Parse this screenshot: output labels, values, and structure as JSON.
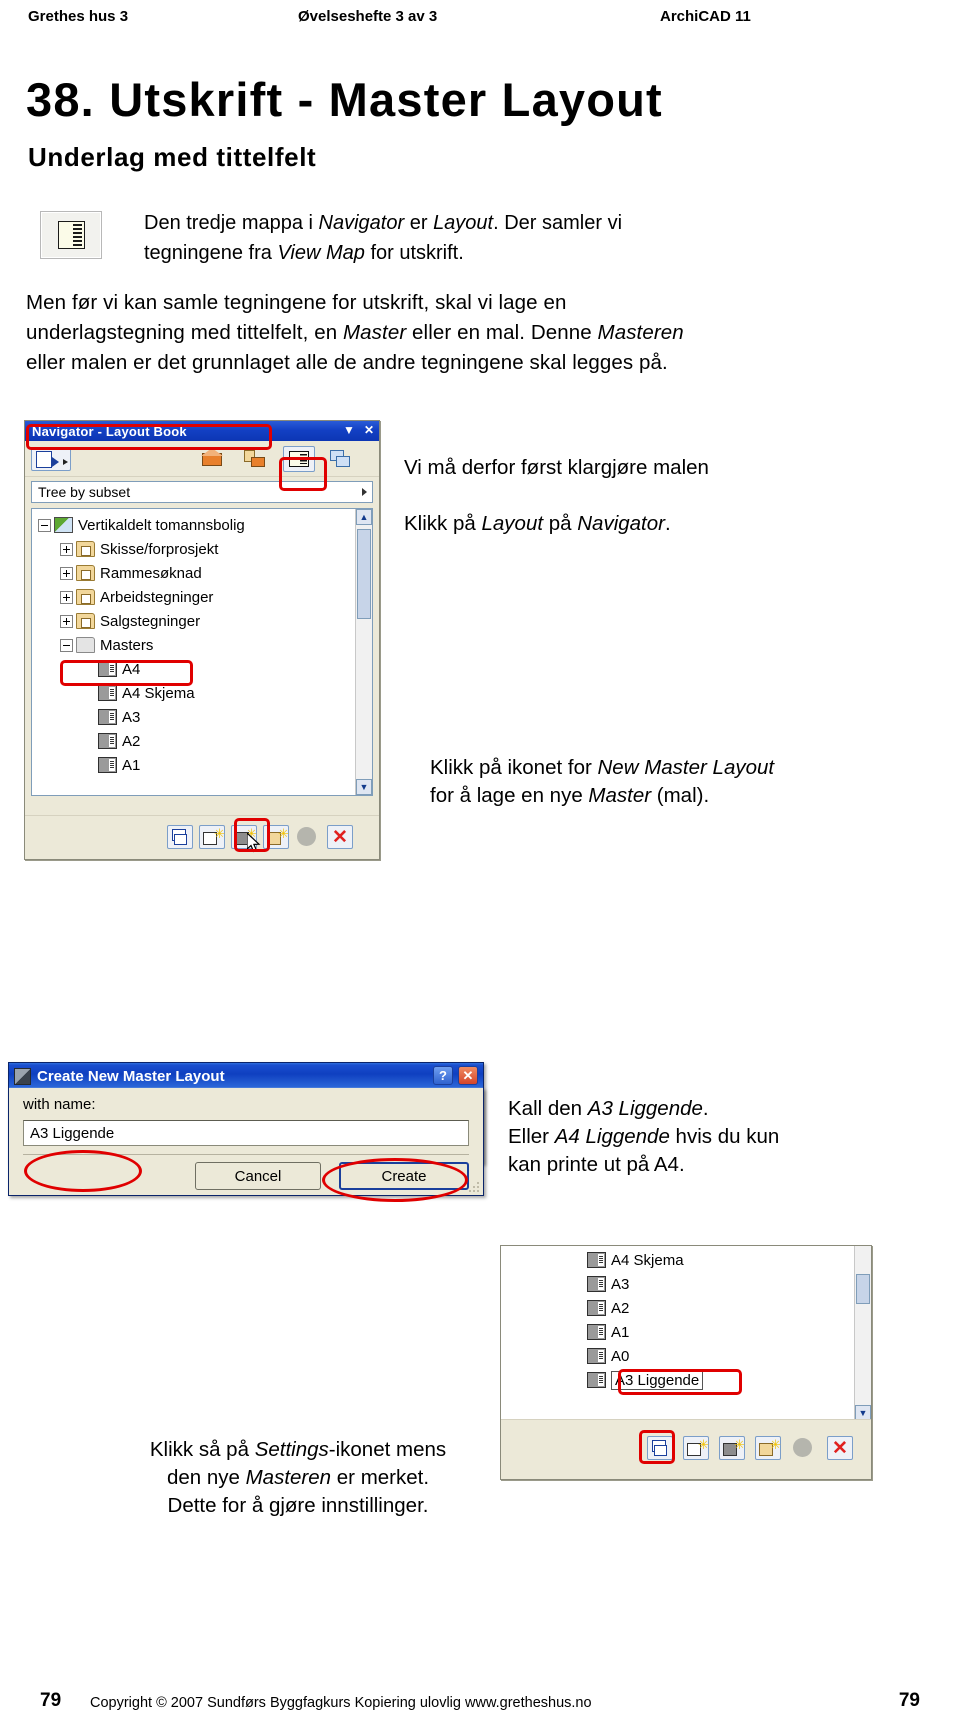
{
  "header": {
    "left": "Grethes hus 3",
    "center": "Øvelseshefte 3 av 3",
    "right": "ArchiCAD 11"
  },
  "title": "38. Utskrift - Master Layout",
  "subtitle": "Underlag med tittelfelt",
  "intro": {
    "icon_name": "layout-book-icon",
    "line1_a": "Den tredje mappa i ",
    "line1_em1": "Navigator",
    "line1_b": " er ",
    "line1_em2": "Layout",
    "line1_c": ".  Der samler vi",
    "line2_a": "tegningene fra ",
    "line2_em1": "View Map",
    "line2_b": " for utskrift."
  },
  "paragraph": {
    "l1": "Men før vi kan samle tegningene for utskrift, skal vi lage en",
    "l2_a": "underlagstegning med tittelfelt, en ",
    "l2_em1": "Master",
    "l2_b": " eller en mal.  Denne ",
    "l2_em2": "Masteren",
    "l3_a": "eller malen er det grunnlaget alle de andre tegningene skal legges på."
  },
  "navigator": {
    "title": "Navigator - Layout Book",
    "titlebar_buttons": [
      "▼",
      "✕"
    ],
    "toolbar_icons": [
      "navigate-export-icon",
      "project-map-icon",
      "view-map-icon",
      "layout-book-icon",
      "publisher-icon"
    ],
    "combo_value": "Tree by subset",
    "tree": [
      {
        "label": "Vertikaldelt tomannsbolig",
        "indent": 0,
        "expander": "minus",
        "icon": "project-icon"
      },
      {
        "label": "Skisse/forprosjekt",
        "indent": 1,
        "expander": "plus",
        "icon": "subset-folder-icon"
      },
      {
        "label": "Rammesøknad",
        "indent": 1,
        "expander": "plus",
        "icon": "subset-folder-icon"
      },
      {
        "label": "Arbeidstegninger",
        "indent": 1,
        "expander": "plus",
        "icon": "subset-folder-icon"
      },
      {
        "label": "Salgstegninger",
        "indent": 1,
        "expander": "plus",
        "icon": "subset-folder-icon"
      },
      {
        "label": "Masters",
        "indent": 1,
        "expander": "minus",
        "icon": "masters-folder-icon"
      },
      {
        "label": "A4",
        "indent": 2,
        "expander": "none",
        "icon": "master-layout-icon"
      },
      {
        "label": "A4 Skjema",
        "indent": 2,
        "expander": "none",
        "icon": "master-layout-icon"
      },
      {
        "label": "A3",
        "indent": 2,
        "expander": "none",
        "icon": "master-layout-active-icon"
      },
      {
        "label": "A2",
        "indent": 2,
        "expander": "none",
        "icon": "master-layout-icon"
      },
      {
        "label": "A1",
        "indent": 2,
        "expander": "none",
        "icon": "master-layout-icon"
      }
    ],
    "bottom_icons": [
      "settings-icon",
      "new-layout-icon",
      "new-master-layout-icon",
      "new-subset-icon",
      "update-icon",
      "delete-icon"
    ]
  },
  "tips": {
    "t1": "Vi må derfor først klargjøre malen",
    "t2_a": "Klikk på ",
    "t2_em": "Layout",
    "t2_b": " på ",
    "t2_em2": "Navigator",
    "t2_c": ".",
    "t3_a": "Klikk på ikonet for ",
    "t3_em": "New Master Layout",
    "t3_l2_a": "for å lage en nye ",
    "t3_em2": "Master",
    "t3_l2_b": " (mal).",
    "t4_l1_a": "Kall den ",
    "t4_l1_em": "A3 Liggende",
    "t4_l1_b": ".",
    "t4_l2_a": "Eller ",
    "t4_l2_em": "A4 Liggende",
    "t4_l2_b": " hvis du kun",
    "t4_l3": "kan printe ut på A4.",
    "t5_l1_a": "Klikk så på ",
    "t5_l1_em": "Settings",
    "t5_l1_b": "-ikonet mens",
    "t5_l2_a": "den nye ",
    "t5_l2_em": "Masteren",
    "t5_l2_b": " er merket.",
    "t5_l3": "Dette for å gjøre innstillinger."
  },
  "dialog": {
    "title": "Create New Master Layout",
    "help_button": "?",
    "close_button": "✕",
    "label": "with name:",
    "input_value": "A3 Liggende",
    "cancel_button": "Cancel",
    "create_button": "Create"
  },
  "navigator2": {
    "tree": [
      {
        "label": "A4 Skjema",
        "icon": "master-layout-icon"
      },
      {
        "label": "A3",
        "icon": "master-layout-active-icon"
      },
      {
        "label": "A2",
        "icon": "master-layout-icon"
      },
      {
        "label": "A1",
        "icon": "master-layout-icon"
      },
      {
        "label": "A0",
        "icon": "master-layout-icon"
      },
      {
        "label": "A3 Liggende",
        "icon": "master-layout-icon",
        "selected": true
      }
    ],
    "bottom_icons": [
      "settings-icon",
      "new-layout-icon",
      "new-master-layout-icon",
      "new-subset-icon",
      "update-icon",
      "delete-icon"
    ]
  },
  "footer": {
    "page_left": "79",
    "page_right": "79",
    "text": "Copyright © 2007  Sundførs Byggfagkurs   Kopiering ulovlig  www.gretheshus.no"
  },
  "colors": {
    "annotation_red": "#e00000",
    "titlebar_blue": "#0c36b4",
    "xp_blue": "#0f3fc0"
  }
}
